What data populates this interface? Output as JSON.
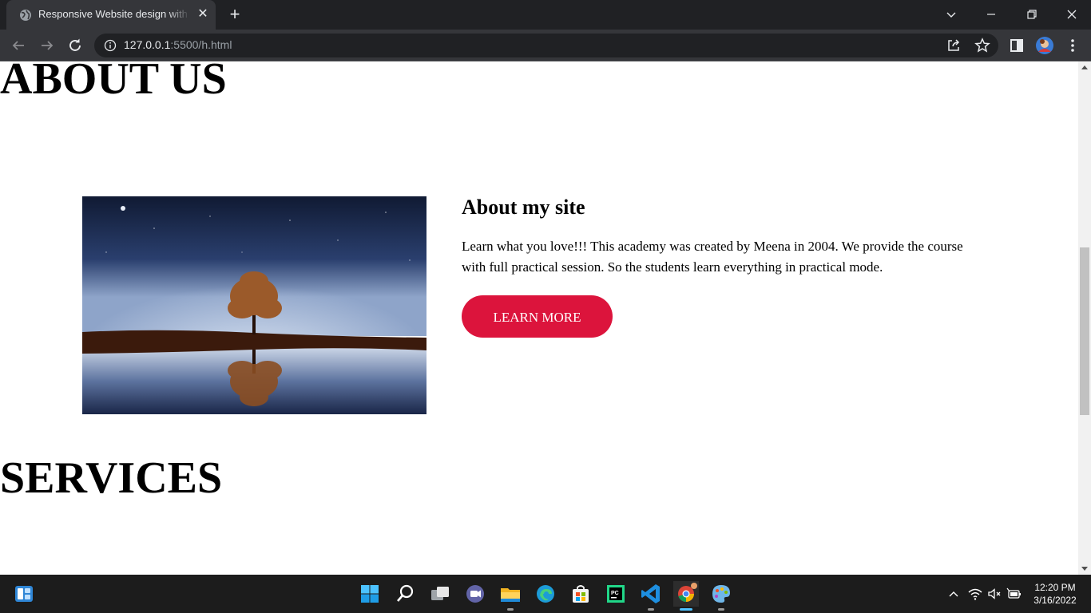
{
  "browser": {
    "tab_title": "Responsive Website design with HTML",
    "url_host": "127.0.0.1",
    "url_rest": ":5500/h.html"
  },
  "page": {
    "about_heading": "ABOUT US",
    "about_subheading": "About my site",
    "about_text": "Learn what you love!!! This academy was created by Meena in 2004. We provide the course with full practical session. So the students learn everything in practical mode.",
    "learn_more_label": "LEARN MORE",
    "services_heading": "SERVICES",
    "accent_color": "#dc143c"
  },
  "taskbar": {
    "apps": [
      "start-icon",
      "search-icon",
      "task-view-icon",
      "teams-chat-icon",
      "file-explorer-icon",
      "edge-icon",
      "store-icon",
      "pycharm-icon",
      "vscode-icon",
      "chrome-icon",
      "paint-icon"
    ],
    "time": "12:20 PM",
    "date": "3/16/2022"
  }
}
